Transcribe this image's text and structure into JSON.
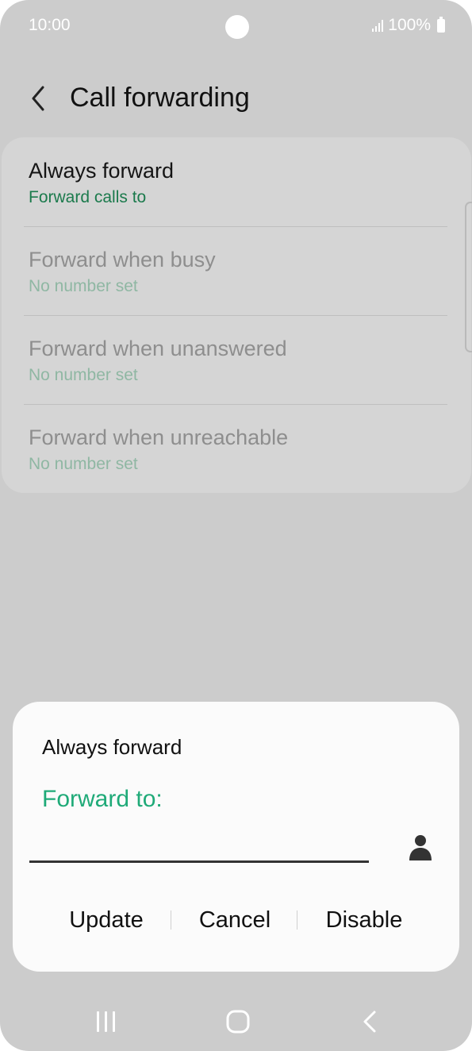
{
  "status_bar": {
    "time": "10:00",
    "battery": "100%"
  },
  "header": {
    "title": "Call forwarding"
  },
  "forwarding_options": [
    {
      "title": "Always forward",
      "subtitle": "Forward calls to"
    },
    {
      "title": "Forward when busy",
      "subtitle": "No number set"
    },
    {
      "title": "Forward when unanswered",
      "subtitle": "No number set"
    },
    {
      "title": "Forward when unreachable",
      "subtitle": "No number set"
    }
  ],
  "dialog": {
    "title": "Always forward",
    "field_label": "Forward to:",
    "field_value": "",
    "buttons": {
      "update": "Update",
      "cancel": "Cancel",
      "disable": "Disable"
    }
  },
  "icons": {
    "back": "chevron-left-icon",
    "contact": "person-icon",
    "nav_recents": "recents-icon",
    "nav_home": "home-icon",
    "nav_back": "back-icon"
  },
  "colors": {
    "accent_green": "#1faa78",
    "subtitle_green": "#1b7a4c",
    "dim_overlay": "#cccccc"
  }
}
